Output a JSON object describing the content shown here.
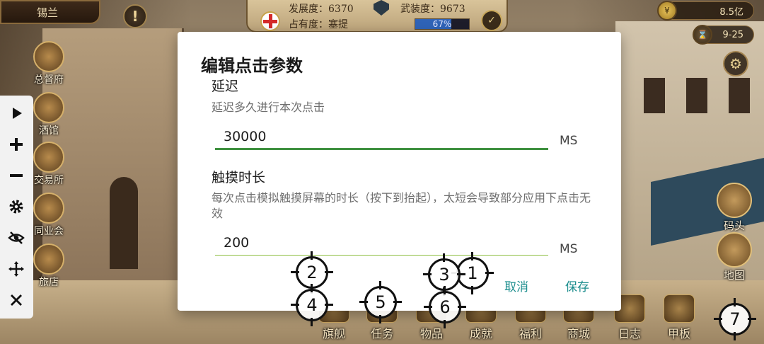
{
  "game": {
    "city_name": "锡兰",
    "alert_symbol": "!",
    "stats": {
      "development": "发展度：6370",
      "armament": "武装度：9673",
      "occupancy": "占有度：塞提",
      "occupancy_percent_label": "67%",
      "occupancy_fraction": 0.67
    },
    "map_glyph": "✓",
    "gold": "8.5亿",
    "date": "9-25",
    "left_menu": [
      {
        "label": "总督府"
      },
      {
        "label": "酒馆"
      },
      {
        "label": "交易所"
      },
      {
        "label": "同业会"
      },
      {
        "label": "旅店"
      }
    ],
    "right_menu": [
      {
        "label": "码头"
      },
      {
        "label": "地图"
      }
    ],
    "bottom_menu": [
      {
        "label": "旗舰"
      },
      {
        "label": "任务"
      },
      {
        "label": "物品"
      },
      {
        "label": "成就"
      },
      {
        "label": "福利"
      },
      {
        "label": "商城"
      },
      {
        "label": "日志"
      },
      {
        "label": "甲板"
      }
    ]
  },
  "tool_panel": {
    "buttons": [
      {
        "name": "play-icon"
      },
      {
        "name": "plus-icon"
      },
      {
        "name": "minus-icon"
      },
      {
        "name": "gear-icon"
      },
      {
        "name": "eye-off-icon"
      },
      {
        "name": "move-icon"
      },
      {
        "name": "close-icon"
      }
    ]
  },
  "dialog": {
    "title": "编辑点击参数",
    "delay": {
      "label": "延迟",
      "description": "延迟多久进行本次点击",
      "value": "30000",
      "unit": "MS"
    },
    "duration": {
      "label": "触摸时长",
      "description": "每次点击模拟触摸屏幕的时长（按下到抬起），太短会导致部分应用下点击无效",
      "value": "200",
      "unit": "MS"
    },
    "cancel_label": "取消",
    "save_label": "保存"
  },
  "markers": [
    {
      "number": "1"
    },
    {
      "number": "2"
    },
    {
      "number": "3"
    },
    {
      "number": "4"
    },
    {
      "number": "5"
    },
    {
      "number": "6"
    },
    {
      "number": "7"
    }
  ]
}
